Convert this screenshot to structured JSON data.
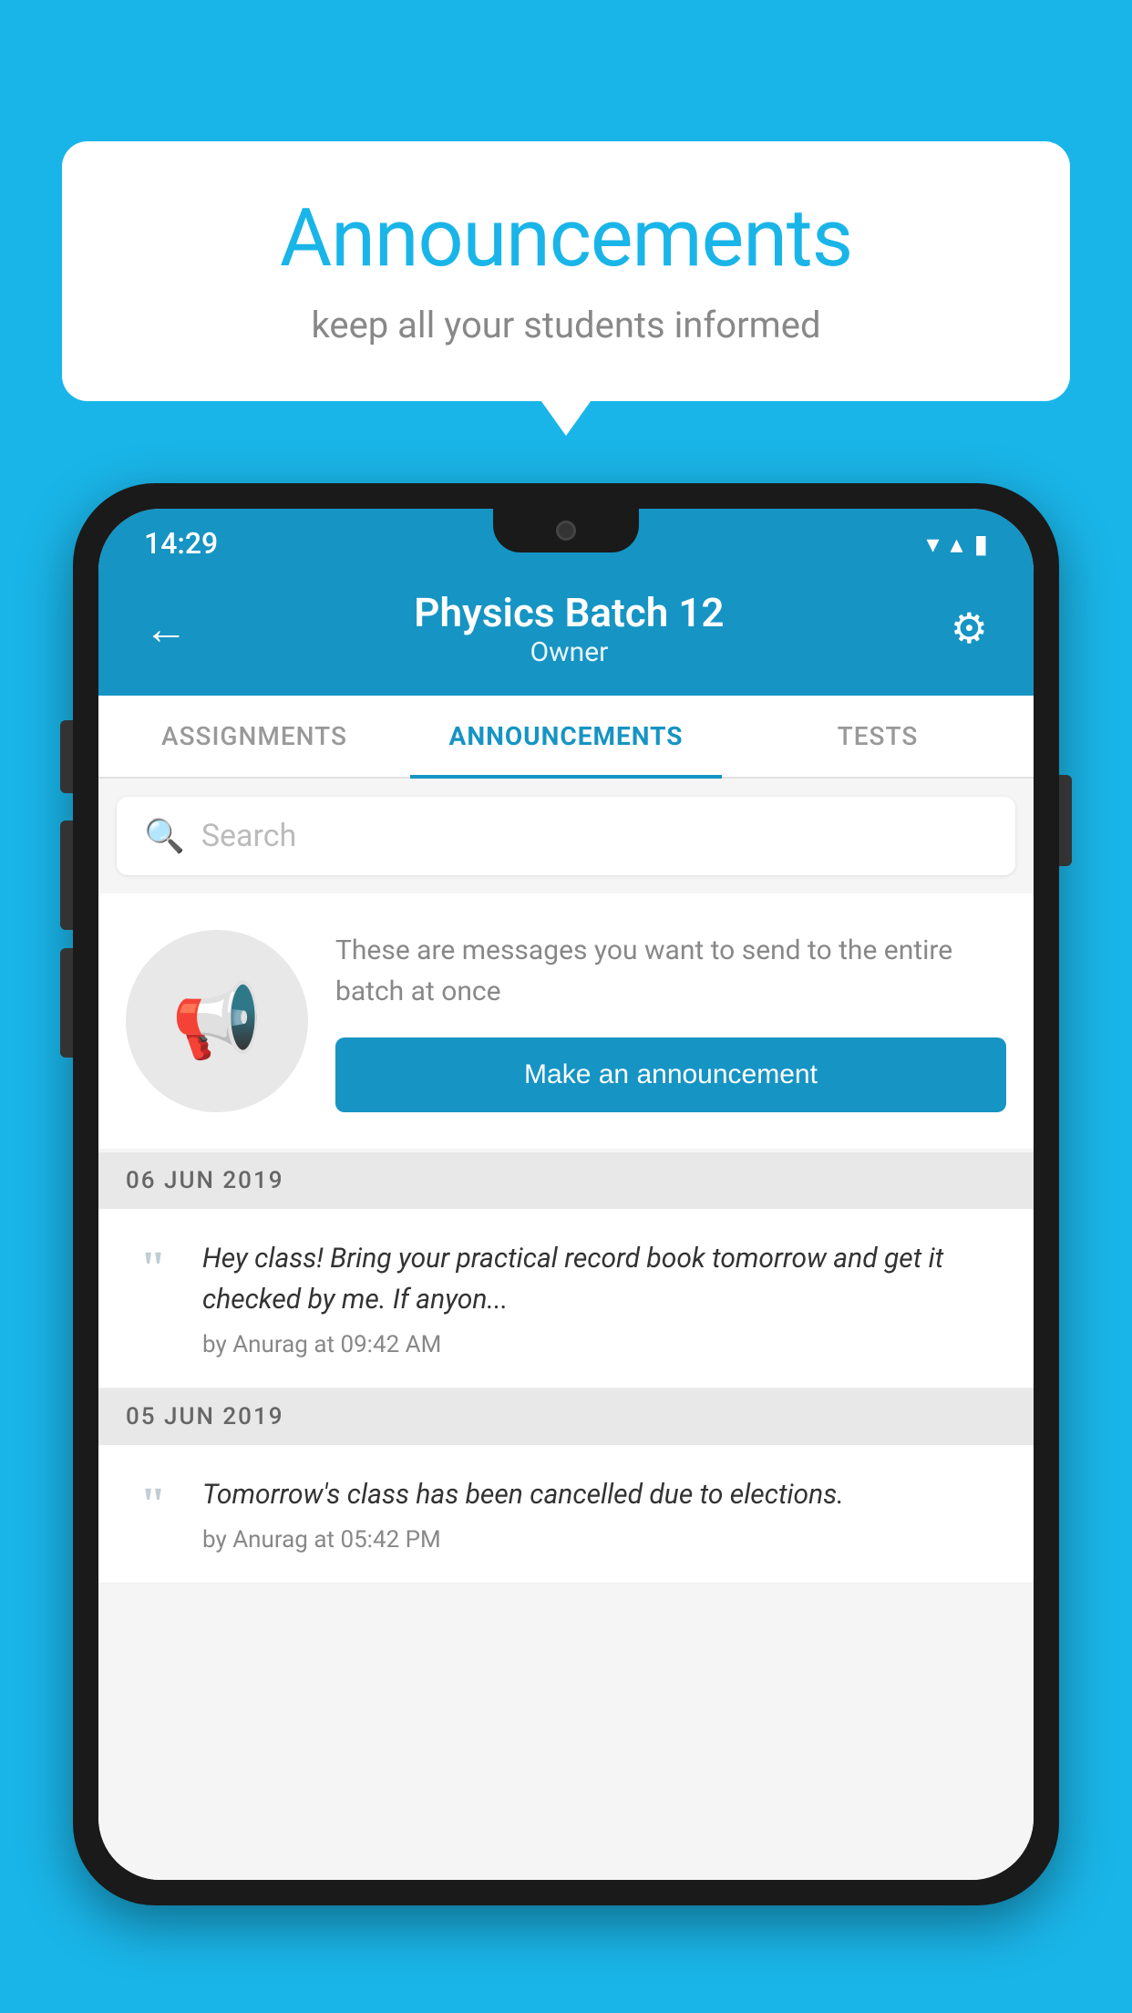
{
  "page": {
    "background_color": "#1ab5e8"
  },
  "speech_bubble": {
    "title": "Announcements",
    "subtitle": "keep all your students informed"
  },
  "phone": {
    "status_bar": {
      "time": "14:29",
      "wifi": "▼",
      "signal": "▲",
      "battery": "▮"
    },
    "header": {
      "back_label": "←",
      "title": "Physics Batch 12",
      "subtitle": "Owner",
      "settings_label": "⚙"
    },
    "tabs": [
      {
        "label": "ASSIGNMENTS",
        "active": false
      },
      {
        "label": "ANNOUNCEMENTS",
        "active": true
      },
      {
        "label": "TESTS",
        "active": false
      },
      {
        "label": "...",
        "active": false
      }
    ],
    "search": {
      "placeholder": "Search"
    },
    "empty_state": {
      "description": "These are messages you want to send to the entire batch at once",
      "button_label": "Make an announcement"
    },
    "announcements": [
      {
        "date": "06  JUN  2019",
        "message": "Hey class! Bring your practical record book tomorrow and get it checked by me. If anyon...",
        "meta": "by Anurag at 09:42 AM"
      },
      {
        "date": "05  JUN  2019",
        "message": "Tomorrow's class has been cancelled due to elections.",
        "meta": "by Anurag at 05:42 PM"
      }
    ]
  }
}
